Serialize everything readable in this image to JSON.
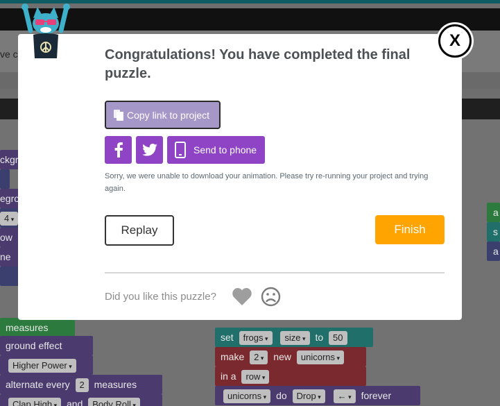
{
  "background": {
    "title_fragment": "ve c",
    "left_stubs": [
      "ckgro",
      "egro",
      "ow",
      "ne"
    ],
    "left_values": [
      "4"
    ],
    "blocks": {
      "measures": "measures",
      "ground_effect": "ground effect",
      "higher_power": "Higher Power",
      "alternate_every": "alternate every",
      "alternate_num": "2",
      "alternate_measures": "measures",
      "clap_high": "Clap High",
      "and": "and",
      "body_roll": "Body Roll",
      "set": "set",
      "frogs": "frogs",
      "size": "size",
      "to": "to",
      "size_val": "50",
      "make": "make",
      "make_num": "2",
      "new": "new",
      "unicorns": "unicorns",
      "in_a": "in a",
      "row": "row",
      "unicorns2": "unicorns",
      "do": "do",
      "drop": "Drop",
      "arrow": "←",
      "forever": "forever",
      "right_stubs": [
        "a",
        "s",
        "a"
      ]
    }
  },
  "dialog": {
    "headline": "Congratulations! You have completed the final puzzle.",
    "copy_link_label": "Copy link to project",
    "send_to_phone_label": "Send to phone",
    "error_message": "Sorry, we were unable to download your animation. Please try re-running your project and trying again.",
    "replay_label": "Replay",
    "finish_label": "Finish",
    "feedback_prompt": "Did you like this puzzle?",
    "close_label": "X"
  },
  "colors": {
    "accent_purple": "#8e44c4",
    "copy_button": "#a697c9",
    "finish_orange": "#ffa400"
  },
  "icons": [
    "copy-icon",
    "facebook-icon",
    "twitter-icon",
    "phone-icon",
    "heart-icon",
    "frown-icon",
    "dance-party-cat-mascot"
  ]
}
